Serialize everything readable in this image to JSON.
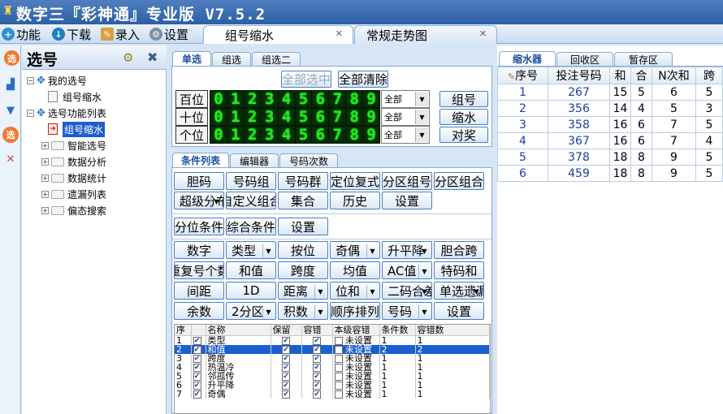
{
  "app": {
    "title": "数字三『彩神通』专业版  V7.5.2"
  },
  "menu": {
    "items": [
      {
        "label": "功能",
        "icon": "plus-icon"
      },
      {
        "label": "下载",
        "icon": "download-icon"
      },
      {
        "label": "录入",
        "icon": "input-icon"
      },
      {
        "label": "设置",
        "icon": "settings-icon"
      }
    ]
  },
  "doc_tabs": [
    {
      "label": "组号缩水",
      "active": true
    },
    {
      "label": "常规走势图",
      "active": false
    }
  ],
  "left_panel": {
    "title": "选号",
    "tree": [
      {
        "label": "我的选号",
        "level": 0,
        "expander": "-"
      },
      {
        "label": "组号缩水",
        "level": 1,
        "expander": ""
      },
      {
        "label": "选号功能列表",
        "level": 0,
        "expander": "-"
      },
      {
        "label": "组号缩水",
        "level": 1,
        "expander": "",
        "selected": true
      },
      {
        "label": "智能选号",
        "level": 1,
        "expander": "+"
      },
      {
        "label": "数据分析",
        "level": 1,
        "expander": "+"
      },
      {
        "label": "数据统计",
        "level": 1,
        "expander": "+"
      },
      {
        "label": "遗漏列表",
        "level": 1,
        "expander": "+"
      },
      {
        "label": "偏态搜索",
        "level": 1,
        "expander": "+"
      }
    ]
  },
  "select_tabs": [
    "单选",
    "组选",
    "组选二"
  ],
  "selector": {
    "select_all": "全部选中",
    "clear_all": "全部清除",
    "rows": [
      {
        "label": "百位",
        "dropdown": "全部"
      },
      {
        "label": "十位",
        "dropdown": "全部"
      },
      {
        "label": "个位",
        "dropdown": "全部"
      }
    ],
    "digits": [
      "0",
      "1",
      "2",
      "3",
      "4",
      "5",
      "6",
      "7",
      "8",
      "9"
    ],
    "actions": [
      "组号",
      "缩水",
      "对奖"
    ]
  },
  "condition_tabs": [
    "条件列表",
    "编辑器",
    "号码次数"
  ],
  "condition_buttons": {
    "group1": [
      [
        "胆码",
        "号码组",
        "号码群",
        "定位复式",
        "分区组号",
        "分区组合"
      ],
      [
        "超级分布",
        "自定义组合",
        "集合",
        "历史",
        "设置"
      ]
    ],
    "group2": [
      [
        "分位条件",
        "综合条件",
        "设置"
      ]
    ],
    "group3": [
      [
        "数字",
        "类型",
        "按位",
        "奇偶",
        "升平降",
        "胆合跨"
      ],
      [
        "重复号个数",
        "和值",
        "跨度",
        "均值",
        "AC值",
        "特码和"
      ],
      [
        "间距",
        "1D",
        "距离",
        "位和",
        "二码合差",
        "单选遗漏"
      ],
      [
        "余数",
        "2分区",
        "积数",
        "顺序排列",
        "号码",
        "设置"
      ]
    ]
  },
  "condition_table": {
    "headers": [
      "序",
      "",
      "名称",
      "保留",
      "容错",
      "本级容错",
      "条件数",
      "容错数"
    ],
    "rows": [
      {
        "no": "1",
        "name": "类型",
        "level": "未设置",
        "count": "1",
        "tol": "1"
      },
      {
        "no": "2",
        "name": "和值",
        "level": "未设置",
        "count": "2",
        "tol": "2",
        "selected": true
      },
      {
        "no": "3",
        "name": "跨度",
        "level": "未设置",
        "count": "1",
        "tol": "1"
      },
      {
        "no": "4",
        "name": "热温冷",
        "level": "未设置",
        "count": "1",
        "tol": "1"
      },
      {
        "no": "5",
        "name": "邻孤传",
        "level": "未设置",
        "count": "1",
        "tol": "1"
      },
      {
        "no": "6",
        "name": "升平降",
        "level": "未设置",
        "count": "1",
        "tol": "1"
      },
      {
        "no": "7",
        "name": "奇偶",
        "level": "未设置",
        "count": "1",
        "tol": "1"
      }
    ]
  },
  "result_tabs": [
    "缩水器",
    "回收区",
    "暂存区"
  ],
  "result_table": {
    "headers": [
      "序号",
      "投注号码",
      "和",
      "合",
      "N次和",
      "跨"
    ],
    "rows": [
      [
        "1",
        "267",
        "15",
        "5",
        "6",
        "5"
      ],
      [
        "2",
        "356",
        "14",
        "4",
        "5",
        "3"
      ],
      [
        "3",
        "358",
        "16",
        "6",
        "7",
        "5"
      ],
      [
        "4",
        "367",
        "16",
        "6",
        "7",
        "4"
      ],
      [
        "5",
        "378",
        "18",
        "8",
        "9",
        "5"
      ],
      [
        "6",
        "459",
        "18",
        "8",
        "9",
        "5"
      ]
    ]
  }
}
